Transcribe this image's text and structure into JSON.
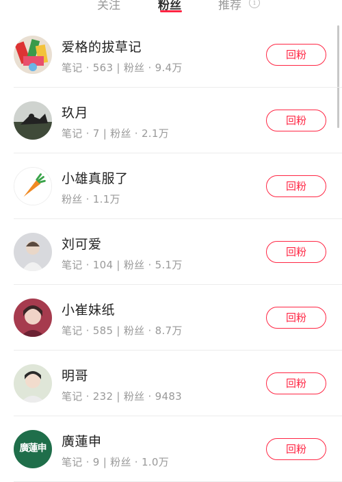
{
  "tabs": [
    {
      "label": "关注"
    },
    {
      "label": "粉丝"
    },
    {
      "label": "推荐"
    }
  ],
  "colors": {
    "accent": "#ff2442"
  },
  "followers": [
    {
      "name": "爱格的拔草记",
      "meta": "笔记 · 563 | 粉丝 · 9.4万",
      "button": "回粉"
    },
    {
      "name": "玖月",
      "meta": "笔记 · 7 | 粉丝 · 2.1万",
      "button": "回粉"
    },
    {
      "name": "小雄真服了",
      "meta": "粉丝 · 1.1万",
      "button": "回粉"
    },
    {
      "name": "刘可爱",
      "meta": "笔记 · 104 | 粉丝 · 5.1万",
      "button": "回粉"
    },
    {
      "name": "小崔妹纸",
      "meta": "笔记 · 585 | 粉丝 · 8.7万",
      "button": "回粉"
    },
    {
      "name": "明哥",
      "meta": "笔记 · 232 | 粉丝 · 9483",
      "button": "回粉"
    },
    {
      "name": "廣蓮申",
      "meta": "笔记 · 9 | 粉丝 · 1.0万",
      "button": "回粉",
      "avatar_text": "廣蓮申"
    }
  ]
}
